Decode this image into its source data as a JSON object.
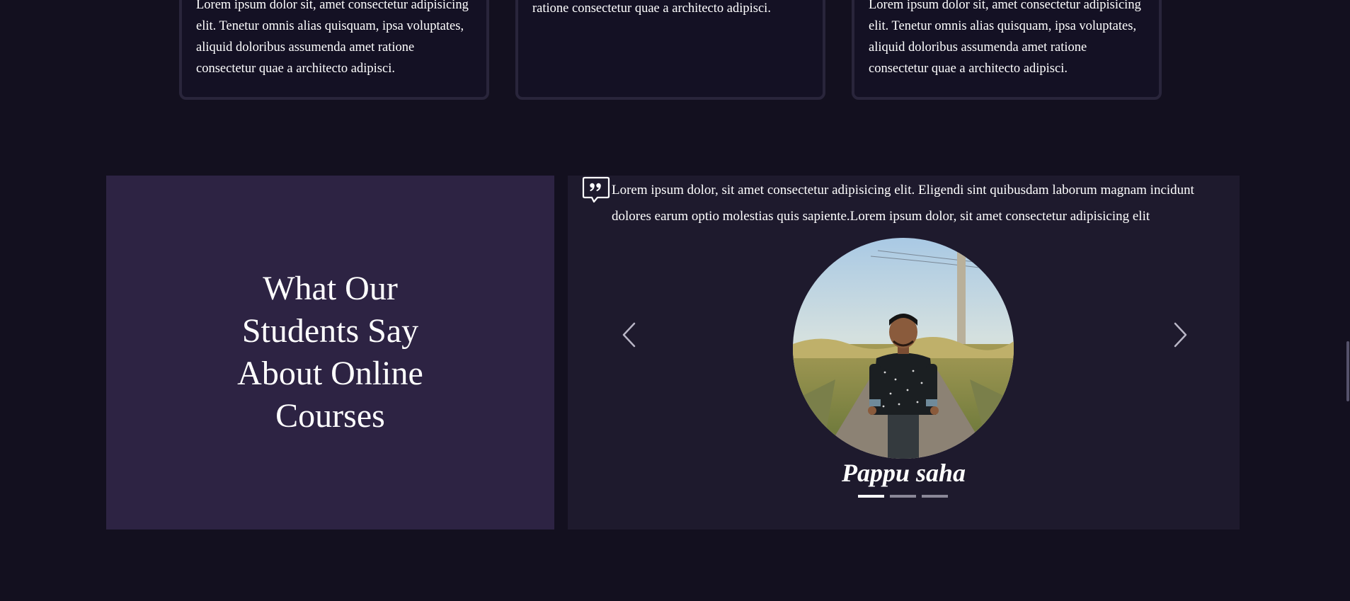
{
  "cards": [
    {
      "text": "Lorem ipsum dolor sit, amet consectetur adipisicing elit. Tenetur omnis alias quisquam, ipsa voluptates, aliquid doloribus assumenda amet ratione consectetur quae a architecto adipisci."
    },
    {
      "text": "ipsa voluptates, aliquid doloribus assumenda amet ratione consectetur quae a architecto adipisci."
    },
    {
      "text": "Lorem ipsum dolor sit, amet consectetur adipisicing elit. Tenetur omnis alias quisquam, ipsa voluptates, aliquid doloribus assumenda amet ratione consectetur quae a architecto adipisci."
    }
  ],
  "testimonials": {
    "heading": "What Our Students Say About Online Courses",
    "quote": "Lorem ipsum dolor, sit amet consectetur adipisicing elit. Eligendi sint quibusdam laborum magnam incidunt dolores earum optio molestias quis sapiente.Lorem ipsum dolor, sit amet consectetur adipisicing elit",
    "student_name": "Pappu saha",
    "slides_total": 3,
    "active_slide": 1
  },
  "icons": {
    "quote": "quote-bubble-icon",
    "prev": "chevron-left-icon",
    "next": "chevron-right-icon"
  },
  "colors": {
    "page_bg": "#13101f",
    "left_panel_bg": "#2d2343",
    "right_panel_bg": "#1e1a2d",
    "card_border": "#29253b",
    "dot_active": "#ffffff",
    "dot_inactive": "#8a8797"
  }
}
